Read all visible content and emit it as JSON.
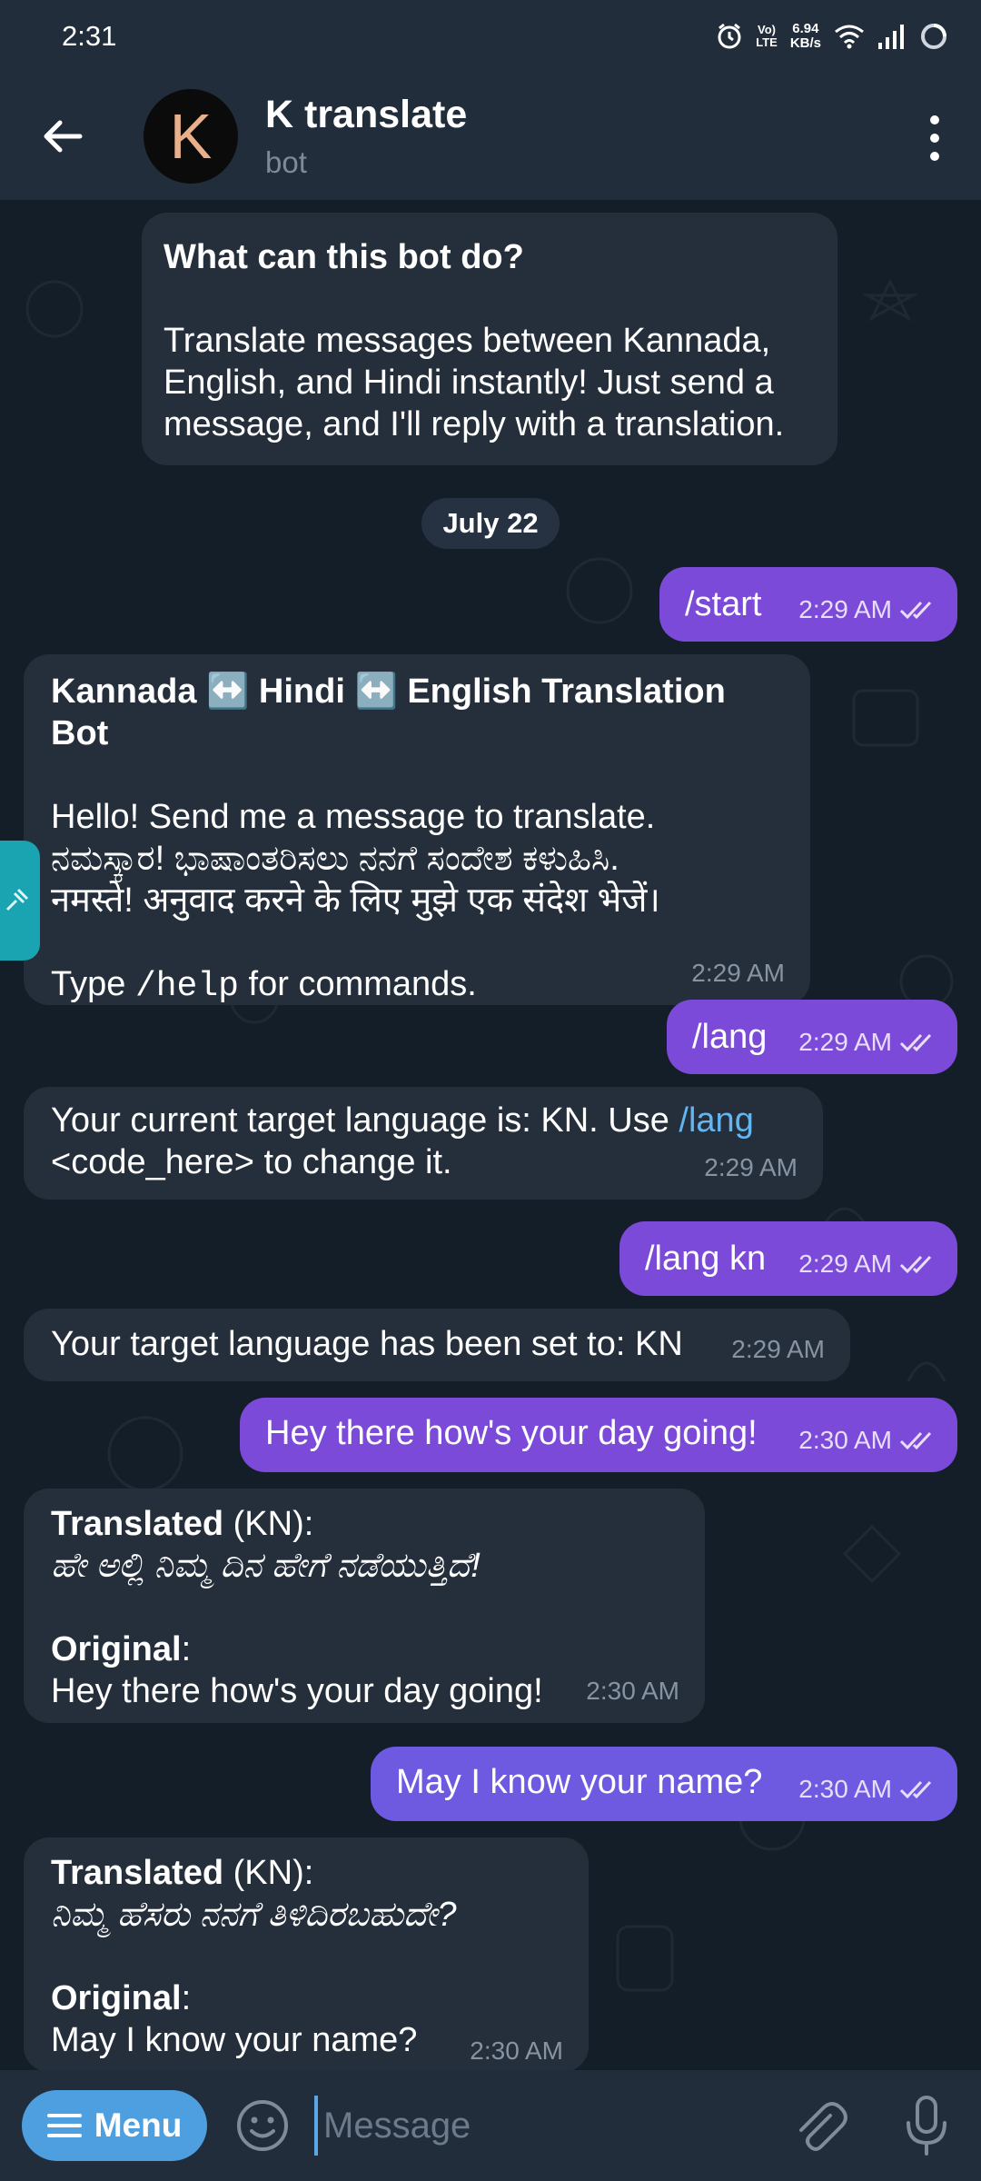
{
  "status_bar": {
    "time": "2:31",
    "volte_top": "Vo)",
    "volte_bottom": "LTE",
    "net_rate_value": "6.94",
    "net_rate_unit": "KB/s"
  },
  "header": {
    "avatar_letter": "K",
    "title": "K translate",
    "subtitle": "bot"
  },
  "chat": {
    "intro": {
      "heading": "What can this bot do?",
      "body": "Translate messages between Kannada, English, and Hindi instantly! Just send a message, and I'll reply with a translation."
    },
    "date_separator": "July 22",
    "messages": [
      {
        "dir": "out",
        "text": "/start",
        "time": "2:29 AM"
      },
      {
        "dir": "in",
        "title": "Kannada ↔️ Hindi ↔️ English Translation Bot",
        "line1": "Hello! Send me a message to translate.",
        "line2": "ನಮಸ್ಕಾರ! ಭಾಷಾಂತರಿಸಲು ನನಗೆ ಸಂದೇಶ ಕಳುಹಿಸಿ.",
        "line3": "नमस्ते! अनुवाद करने के लिए मुझे एक संदेश भेजें।",
        "type_pre": "Type ",
        "type_cmd": "/help",
        "type_post": " for commands.",
        "time": "2:29 AM"
      },
      {
        "dir": "out",
        "text": "/lang",
        "time": "2:29 AM"
      },
      {
        "dir": "in",
        "text_pre": "Your current target language is: KN. Use ",
        "link": "/lang",
        "text_post": "<code_here> to change it.",
        "time": "2:29 AM"
      },
      {
        "dir": "out",
        "text": "/lang kn",
        "time": "2:29 AM"
      },
      {
        "dir": "in",
        "text": "Your target language has been set to: KN",
        "time": "2:29 AM"
      },
      {
        "dir": "out",
        "text": "Hey there how's your day going!",
        "time": "2:30 AM"
      },
      {
        "dir": "in",
        "translated_label": "Translated",
        "translated_code": " (KN):",
        "translated_text": "ಹೇ ಅಲ್ಲಿ ನಿಮ್ಮ ದಿನ ಹೇಗೆ ನಡೆಯುತ್ತಿದೆ!",
        "original_label": "Original",
        "original_colon": ":",
        "original_text": "Hey there how's your day going!",
        "time": "2:30 AM"
      },
      {
        "dir": "out",
        "text": "May I know your name?",
        "time": "2:30 AM"
      },
      {
        "dir": "in",
        "translated_label": "Translated",
        "translated_code": " (KN):",
        "translated_text": "ನಿಮ್ಮ ಹೆಸರು ನನಗೆ ತಿಳಿದಿರಬಹುದೇ?",
        "original_label": "Original",
        "original_colon": ":",
        "original_text": "May I know your name?",
        "time": "2:30 AM"
      }
    ]
  },
  "input_bar": {
    "menu_label": "Menu",
    "placeholder": "Message"
  },
  "colors": {
    "header_bg": "#212d3b",
    "chat_bg": "#141e29",
    "incoming_bubble": "#252f3b",
    "outgoing_bubble": "#7b4ad8",
    "menu_button": "#4e9fe0",
    "link": "#62b6f2"
  }
}
